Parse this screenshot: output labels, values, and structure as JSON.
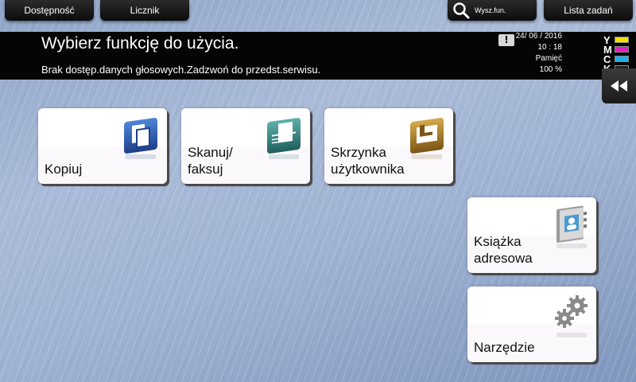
{
  "top_tabs": {
    "availability": "Dostępność",
    "counter": "Licznik",
    "search": "Wysz.fun.",
    "job_list": "Lista zadań"
  },
  "message": {
    "title": "Wybierz funkcję do użycia.",
    "subtitle": "Brak dostęp.danych głosowych.Zadzwoń do przedst.serwisu."
  },
  "status": {
    "date": "24/ 06 / 2016",
    "time": "10 : 18",
    "memory_label": "Pamięć",
    "memory_value": "100 %"
  },
  "toner": [
    {
      "letter": "Y",
      "color": "#f2e200"
    },
    {
      "letter": "M",
      "color": "#e020c0"
    },
    {
      "letter": "C",
      "color": "#1ab0e8"
    },
    {
      "letter": "K",
      "color": "#222222"
    }
  ],
  "tiles": {
    "copy": "Kopiuj",
    "scan_fax": "Skanuj/\nfaksuj",
    "user_box": "Skrzynka\nużytkownika",
    "address_book": "Książka\nadresowa",
    "utility": "Narzędzie"
  },
  "icons": {
    "search": "magnifier-icon",
    "warning": "warning-icon",
    "collapse": "double-chevron-left-icon",
    "copy": "copy-icon",
    "scan": "scan-fax-icon",
    "box": "user-box-icon",
    "address": "address-book-icon",
    "utility": "gears-icon"
  },
  "colors": {
    "copy_icon": "#2f5fb0",
    "scan_icon": "#2e7f7c",
    "box_icon": "#b0872e",
    "address_icon": "#8a8a8a",
    "utility_icon": "#8a8a8a"
  }
}
